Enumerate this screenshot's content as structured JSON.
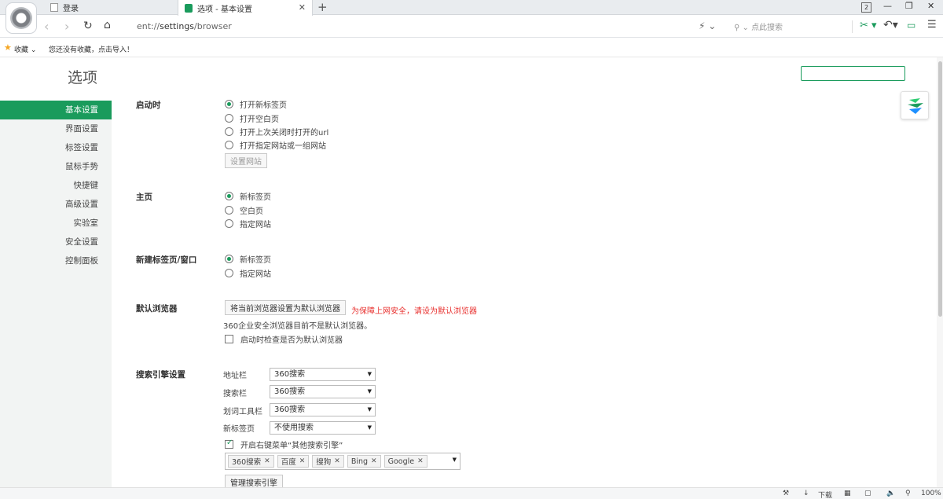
{
  "tabs": [
    {
      "label": "登录"
    },
    {
      "label": "选项 - 基本设置"
    }
  ],
  "tabbar": {
    "tab_count": "2"
  },
  "address": {
    "scheme": "ent://",
    "host": "settings",
    "path": "/browser",
    "search_placeholder": "点此搜索"
  },
  "bookmarks": {
    "label": "收藏",
    "import_text": "您还没有收藏，点击导入！"
  },
  "page": {
    "title": "选项"
  },
  "sidebar": {
    "items": [
      {
        "label": "基本设置"
      },
      {
        "label": "界面设置"
      },
      {
        "label": "标签设置"
      },
      {
        "label": "鼠标手势"
      },
      {
        "label": "快捷键"
      },
      {
        "label": "高级设置"
      },
      {
        "label": "实验室"
      },
      {
        "label": "安全设置"
      },
      {
        "label": "控制面板"
      }
    ]
  },
  "startup": {
    "label": "启动时",
    "options": [
      "打开新标签页",
      "打开空白页",
      "打开上次关闭时打开的url",
      "打开指定网站或一组网站"
    ],
    "selected": 0,
    "button": "设置网站"
  },
  "homepage": {
    "label": "主页",
    "options": [
      "新标签页",
      "空白页",
      "指定网站"
    ],
    "selected": 0
  },
  "newtab": {
    "label": "新建标签页/窗口",
    "options": [
      "新标签页",
      "指定网站"
    ],
    "selected": 0
  },
  "default_browser": {
    "label": "默认浏览器",
    "button": "将当前浏览器设置为默认浏览器",
    "warning": "为保障上网安全，请设为默认浏览器",
    "note": "360企业安全浏览器目前不是默认浏览器。",
    "check_label": "启动时检查是否为默认浏览器",
    "checked": false
  },
  "search_engine": {
    "label": "搜索引擎设置",
    "rows": [
      {
        "label": "地址栏",
        "value": "360搜索"
      },
      {
        "label": "搜索栏",
        "value": "360搜索"
      },
      {
        "label": "划词工具栏",
        "value": "360搜索"
      },
      {
        "label": "新标签页",
        "value": "不使用搜索"
      }
    ],
    "context_menu_label": "开启右键菜单“其他搜索引擎”",
    "context_menu_checked": true,
    "engines": [
      "360搜索",
      "百度",
      "搜狗",
      "Bing",
      "Google"
    ],
    "manage_button": "管理搜索引擎"
  },
  "status": {
    "download": "下载",
    "zoom": "100%"
  },
  "colors": {
    "accent": "#1a9b5c",
    "warning": "#e8302e"
  }
}
